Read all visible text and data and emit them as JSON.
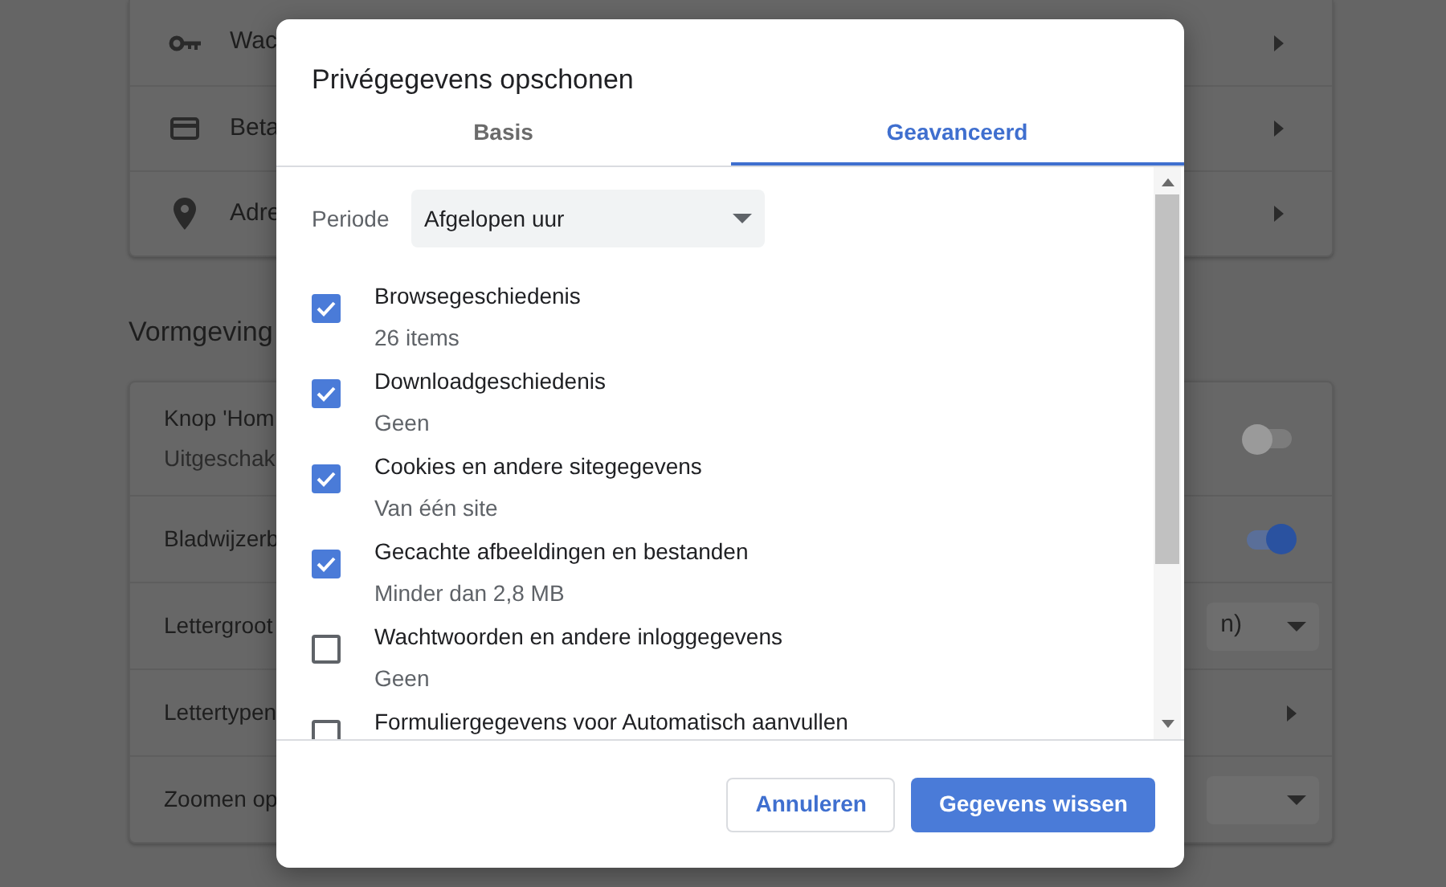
{
  "background": {
    "card_rows": [
      {
        "label": "Wac",
        "kind": "chevron"
      },
      {
        "label": "Beta",
        "kind": "chevron"
      },
      {
        "label": "Adre",
        "kind": "chevron"
      }
    ],
    "section_title": "Vormgeving",
    "appearance_rows": [
      {
        "label": "Knop 'Hom",
        "sublabel": "Uitgeschak",
        "kind": "toggle",
        "on": false
      },
      {
        "label": "Bladwijzerb",
        "kind": "toggle",
        "on": true
      },
      {
        "label": "Lettergroot",
        "kind": "dropdown",
        "value": "n)"
      },
      {
        "label": "Lettertypen",
        "kind": "chevron"
      },
      {
        "label": "Zoomen op",
        "kind": "dropdown"
      }
    ]
  },
  "dialog": {
    "title": "Privégegevens opschonen",
    "tabs": [
      {
        "label": "Basis",
        "selected": false
      },
      {
        "label": "Geavanceerd",
        "selected": true
      }
    ],
    "period": {
      "label": "Periode",
      "value": "Afgelopen uur"
    },
    "items": [
      {
        "title": "Browsegeschiedenis",
        "subtitle": "26 items",
        "checked": true
      },
      {
        "title": "Downloadgeschiedenis",
        "subtitle": "Geen",
        "checked": true
      },
      {
        "title": "Cookies en andere sitegegevens",
        "subtitle": "Van één site",
        "checked": true
      },
      {
        "title": "Gecachte afbeeldingen en bestanden",
        "subtitle": "Minder dan 2,8 MB",
        "checked": true
      },
      {
        "title": "Wachtwoorden en andere inloggegevens",
        "subtitle": "Geen",
        "checked": false
      },
      {
        "title": "Formuliergegevens voor Automatisch aanvullen",
        "checked": false
      }
    ],
    "buttons": [
      {
        "label": "Annuleren",
        "kind": "secondary"
      },
      {
        "label": "Gegevens wissen",
        "kind": "primary"
      }
    ]
  }
}
